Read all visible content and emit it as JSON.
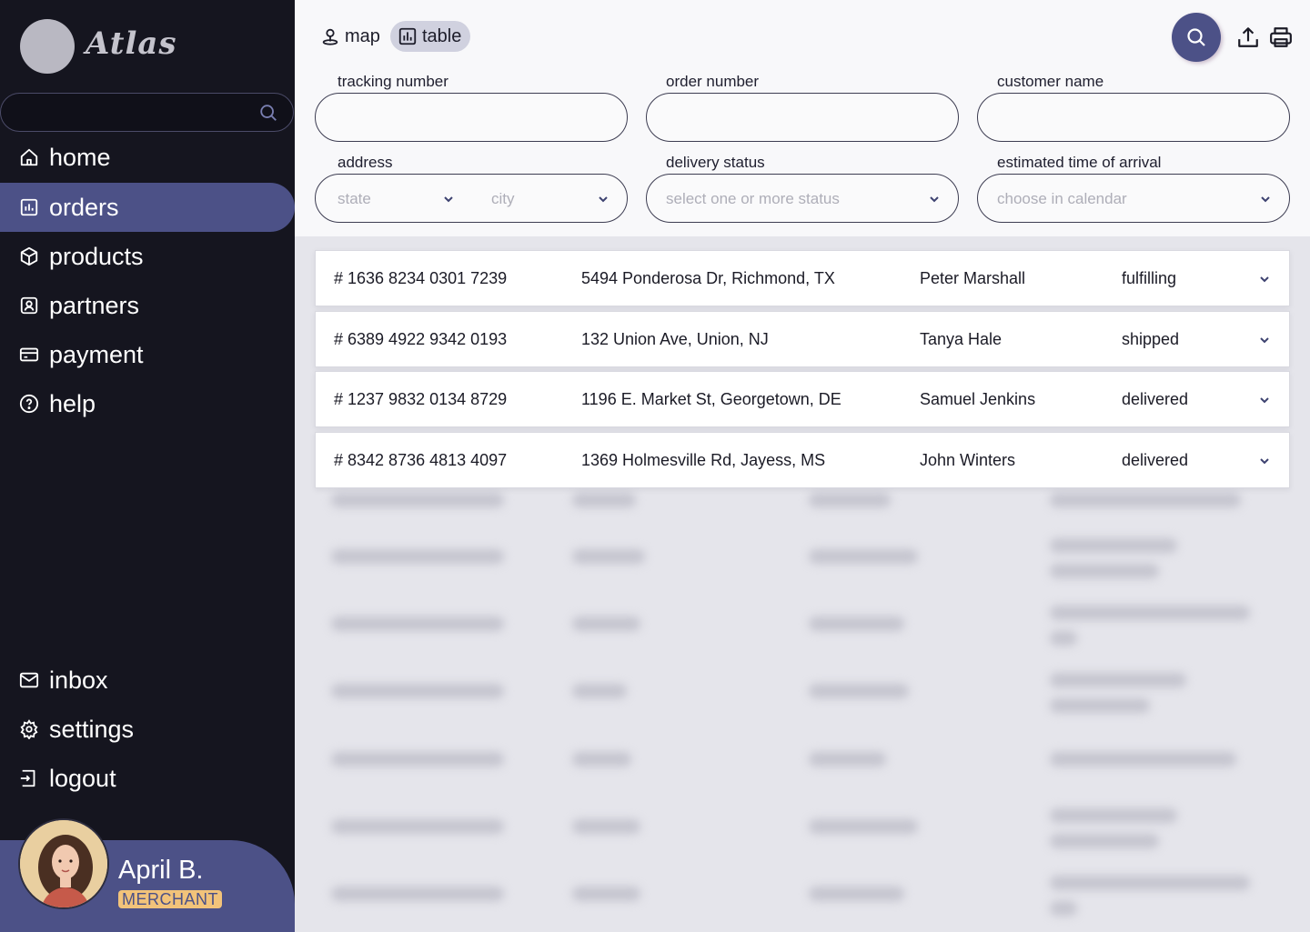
{
  "app": {
    "name": "Atlas"
  },
  "sidebar": {
    "search": {
      "placeholder": ""
    },
    "items": [
      {
        "label": "home",
        "icon": "home-icon",
        "active": false
      },
      {
        "label": "orders",
        "icon": "bar-chart-icon",
        "active": true
      },
      {
        "label": "products",
        "icon": "box-icon",
        "active": false
      },
      {
        "label": "partners",
        "icon": "contact-card-icon",
        "active": false
      },
      {
        "label": "payment",
        "icon": "credit-card-icon",
        "active": false
      },
      {
        "label": "help",
        "icon": "question-icon",
        "active": false
      }
    ],
    "bottom_items": [
      {
        "label": "inbox",
        "icon": "mail-icon"
      },
      {
        "label": "settings",
        "icon": "gear-icon"
      },
      {
        "label": "logout",
        "icon": "logout-icon"
      }
    ],
    "profile": {
      "name": "April B.",
      "role": "MERCHANT"
    }
  },
  "toolbar": {
    "views": [
      {
        "label": "map",
        "icon": "map-pin-icon",
        "active": false
      },
      {
        "label": "table",
        "icon": "table-chart-icon",
        "active": true
      }
    ],
    "actions": [
      "search-icon",
      "upload-icon",
      "print-icon"
    ]
  },
  "filters": {
    "tracking_number": {
      "label": "tracking number",
      "value": ""
    },
    "order_number": {
      "label": "order number",
      "value": ""
    },
    "customer_name": {
      "label": "customer name",
      "value": ""
    },
    "address": {
      "label": "address",
      "state_placeholder": "state",
      "city_placeholder": "city"
    },
    "delivery_status": {
      "label": "delivery status",
      "placeholder": "select one or more status"
    },
    "eta": {
      "label": "estimated time of arrival",
      "placeholder": "choose in calendar"
    }
  },
  "orders": [
    {
      "tracking": "# 1636 8234 0301 7239",
      "address": "5494 Ponderosa Dr, Richmond, TX",
      "customer": "Peter Marshall",
      "status": "fulfilling"
    },
    {
      "tracking": "# 6389 4922 9342 0193",
      "address": "132 Union Ave, Union, NJ",
      "customer": "Tanya Hale",
      "status": "shipped"
    },
    {
      "tracking": "# 1237 9832 0134 8729",
      "address": "1196 E. Market St, Georgetown, DE",
      "customer": "Samuel Jenkins",
      "status": "delivered"
    },
    {
      "tracking": "# 8342 8736 4813 4097",
      "address": "1369 Holmesville Rd, Jayess, MS",
      "customer": "John Winters",
      "status": "delivered"
    }
  ],
  "colors": {
    "sidebar_bg": "#15151f",
    "accent": "#4c5187",
    "badge": "#f2c37a",
    "table_bg": "#e5e5eb"
  }
}
